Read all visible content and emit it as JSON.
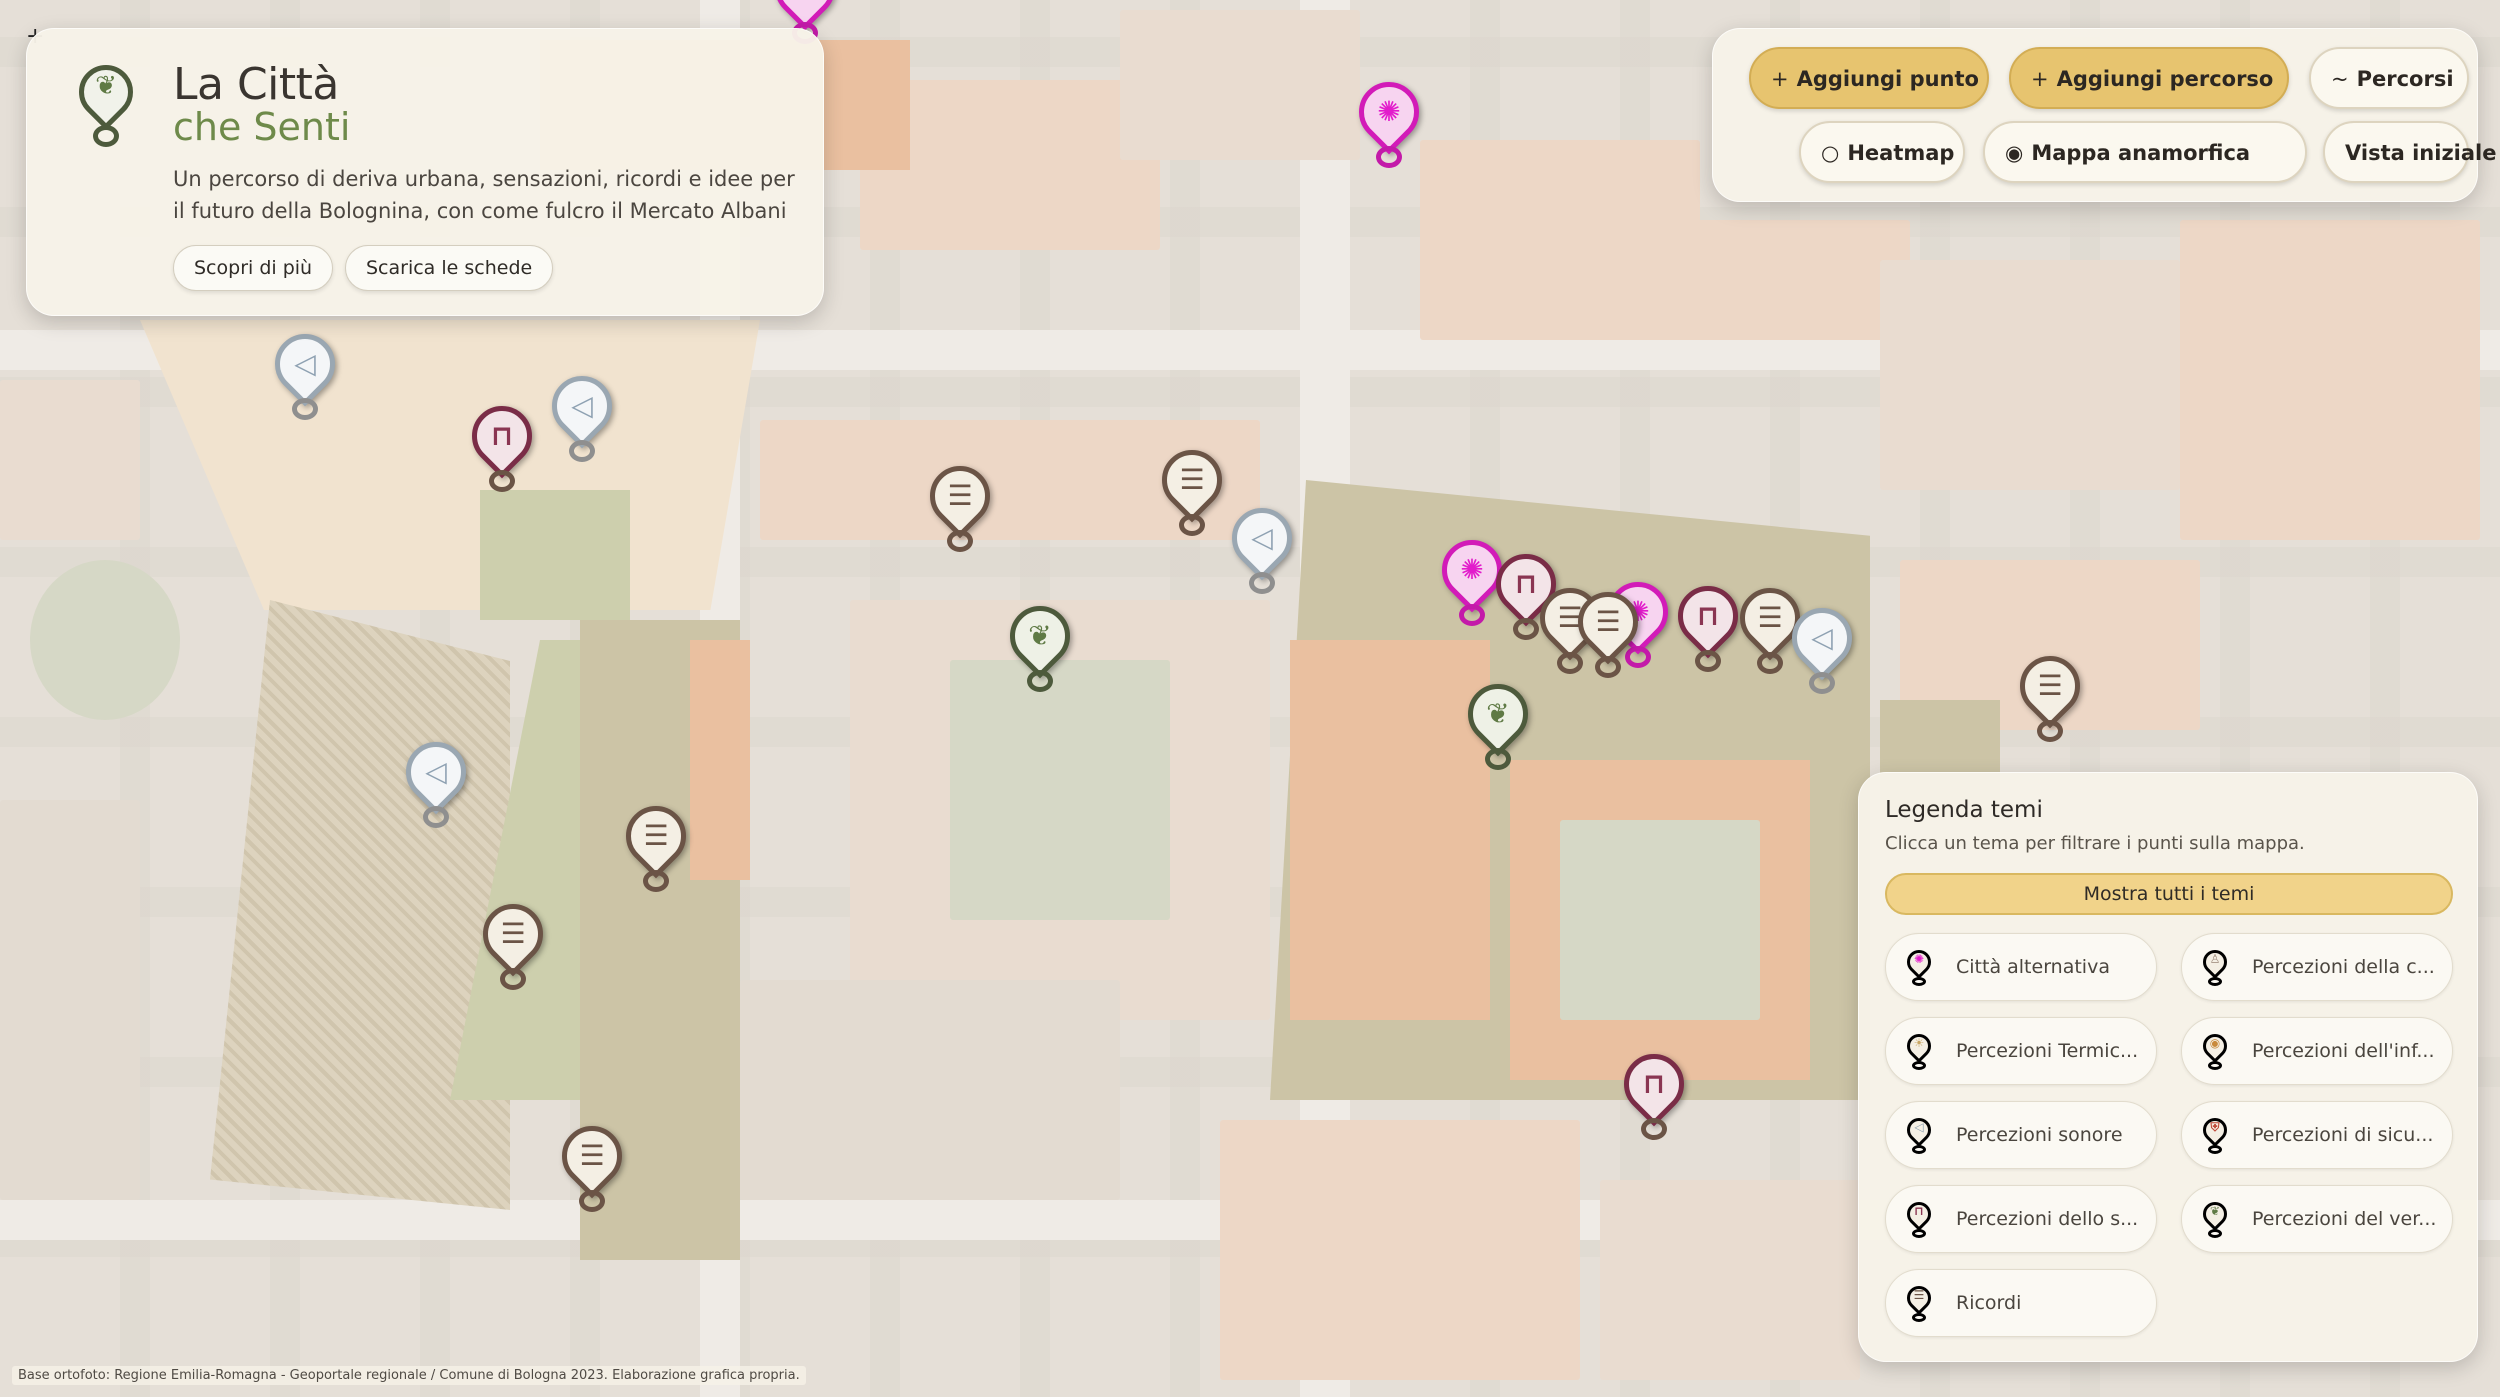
{
  "header": {
    "title_line1": "La Città",
    "title_line2": "che Senti",
    "subtitle": "Un percorso di deriva urbana, sensazioni, ricordi e idee per il futuro della Bolognina, con come fulcro il Mercato Albani",
    "buttons": {
      "discover": "Scopri di più",
      "download": "Scarica le schede"
    },
    "logo_icon": "leaf-pin-icon"
  },
  "toolbar": {
    "add_point": {
      "prefix": "+",
      "label": "Aggiungi punto"
    },
    "add_route": {
      "prefix": "+",
      "label": "Aggiungi percorso"
    },
    "routes": {
      "prefix": "~",
      "label": "Percorsi"
    },
    "heatmap": {
      "prefix": "○",
      "label": "Heatmap"
    },
    "anamorphic": {
      "prefix": "◉",
      "label": "Mappa anamorfica"
    },
    "reset_view": {
      "label": "Vista iniziale"
    },
    "accent_color": "#e7c46f"
  },
  "legend": {
    "title": "Legenda temi",
    "subtitle": "Clicca un tema per filtrare i punti sulla mappa.",
    "show_all": "Mostra tutti i temi",
    "items": [
      {
        "label": "Città alternativa",
        "icon": "starburst-icon",
        "glyph": "✺"
      },
      {
        "label": "Percezioni della c...",
        "icon": "figure-icon",
        "glyph": "♙"
      },
      {
        "label": "Percezioni Termic...",
        "icon": "thermometer-icon",
        "glyph": "☀"
      },
      {
        "label": "Percezioni dell'inf...",
        "icon": "bulb-icon",
        "glyph": "◉"
      },
      {
        "label": "Percezioni sonore",
        "icon": "megaphone-icon",
        "glyph": "◁"
      },
      {
        "label": "Percezioni di sicu...",
        "icon": "shield-icon",
        "glyph": "⛨"
      },
      {
        "label": "Percezioni dello s...",
        "icon": "bench-icon",
        "glyph": "⊓"
      },
      {
        "label": "Percezioni del ver...",
        "icon": "leaf-icon",
        "glyph": "❦"
      },
      {
        "label": "Ricordi",
        "icon": "ladder-icon",
        "glyph": "☰"
      }
    ]
  },
  "map": {
    "attribution": "Base ortofoto: Regione Emilia-Romagna - Geoportale regionale / Comune di Bologna 2023. Elaborazione grafica propria.",
    "corner_control": "+"
  }
}
